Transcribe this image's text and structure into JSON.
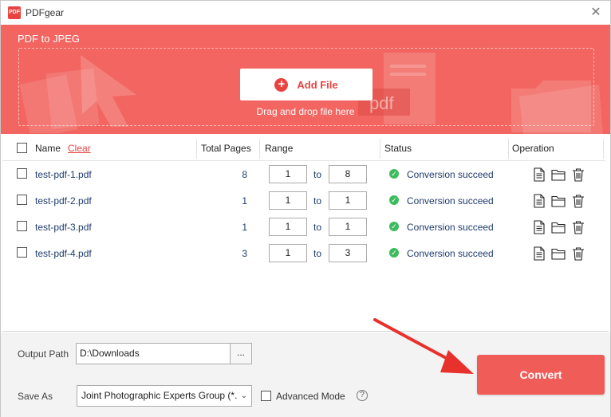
{
  "app": {
    "title": "PDFgear",
    "logo_text": "PDF"
  },
  "banner": {
    "title": "PDF to JPEG",
    "add_file_label": "Add File",
    "drop_text": "Drag and drop file here",
    "deco_text": "pdf"
  },
  "table": {
    "headers": {
      "name": "Name",
      "clear": "Clear",
      "total_pages": "Total Pages",
      "range": "Range",
      "status": "Status",
      "operation": "Operation"
    },
    "to_label": "to",
    "rows": [
      {
        "name": "test-pdf-1.pdf",
        "pages": "8",
        "from": "1",
        "to": "8",
        "status": "Conversion succeed"
      },
      {
        "name": "test-pdf-2.pdf",
        "pages": "1",
        "from": "1",
        "to": "1",
        "status": "Conversion succeed"
      },
      {
        "name": "test-pdf-3.pdf",
        "pages": "1",
        "from": "1",
        "to": "1",
        "status": "Conversion succeed"
      },
      {
        "name": "test-pdf-4.pdf",
        "pages": "3",
        "from": "1",
        "to": "3",
        "status": "Conversion succeed"
      }
    ]
  },
  "output": {
    "label": "Output Path",
    "value": "D:\\Downloads",
    "browse_label": "..."
  },
  "save_as": {
    "label": "Save As",
    "value": "Joint Photographic Experts Group (*."
  },
  "advanced": {
    "label": "Advanced Mode",
    "help_glyph": "?"
  },
  "convert": {
    "label": "Convert"
  },
  "colors": {
    "accent": "#e8433f",
    "banner": "#f26560",
    "success": "#3dbb5e",
    "button": "#f05d59"
  },
  "icons": [
    "close-icon",
    "plus-icon",
    "checkmark-icon",
    "document-icon",
    "folder-icon",
    "trash-icon",
    "chevron-down-icon",
    "help-icon",
    "arrow-icon"
  ]
}
